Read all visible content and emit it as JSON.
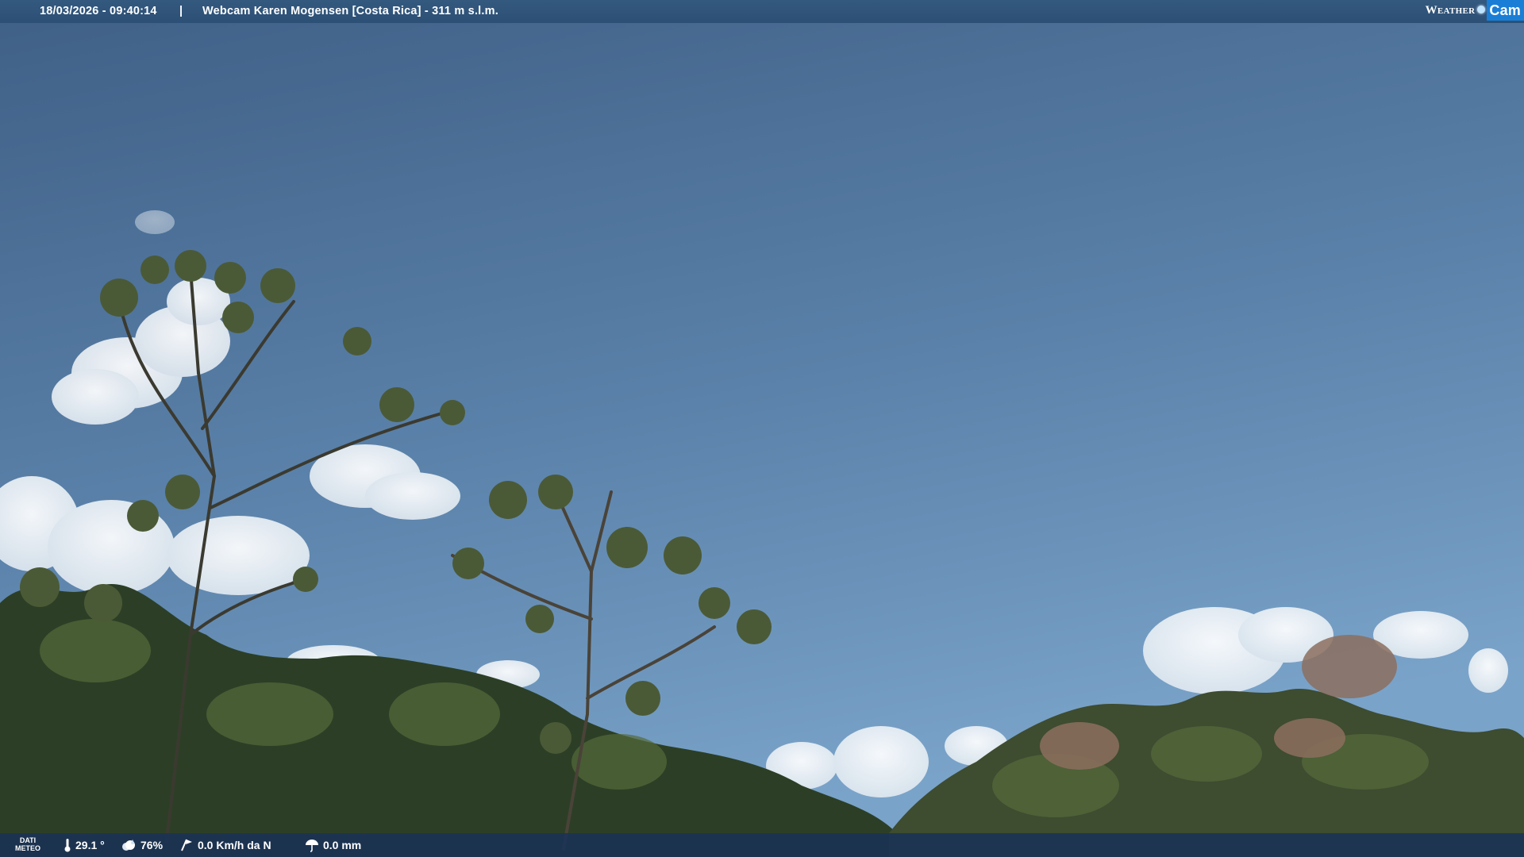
{
  "header": {
    "timestamp": "18/03/2026 - 09:40:14",
    "separator": "|",
    "title": "Webcam Karen Mogensen [Costa Rica] - 311 m s.l.m."
  },
  "logo": {
    "word": "Weather",
    "cam": "Cam",
    "icon": "sun-dot-icon"
  },
  "weather": {
    "label_line1": "DATI",
    "label_line2": "METEO",
    "temperature": "29.1 °",
    "humidity": "76%",
    "wind": "0.0 Km/h da N",
    "rain": "0.0 mm",
    "icons": [
      "thermometer-icon",
      "humidity-icon",
      "wind-icon",
      "rain-icon"
    ]
  },
  "colors": {
    "sky_top": "#3f5f86",
    "sky_bottom": "#6f98c0",
    "bar": "#2c4f75",
    "logo_accent": "#1a7ed6"
  }
}
